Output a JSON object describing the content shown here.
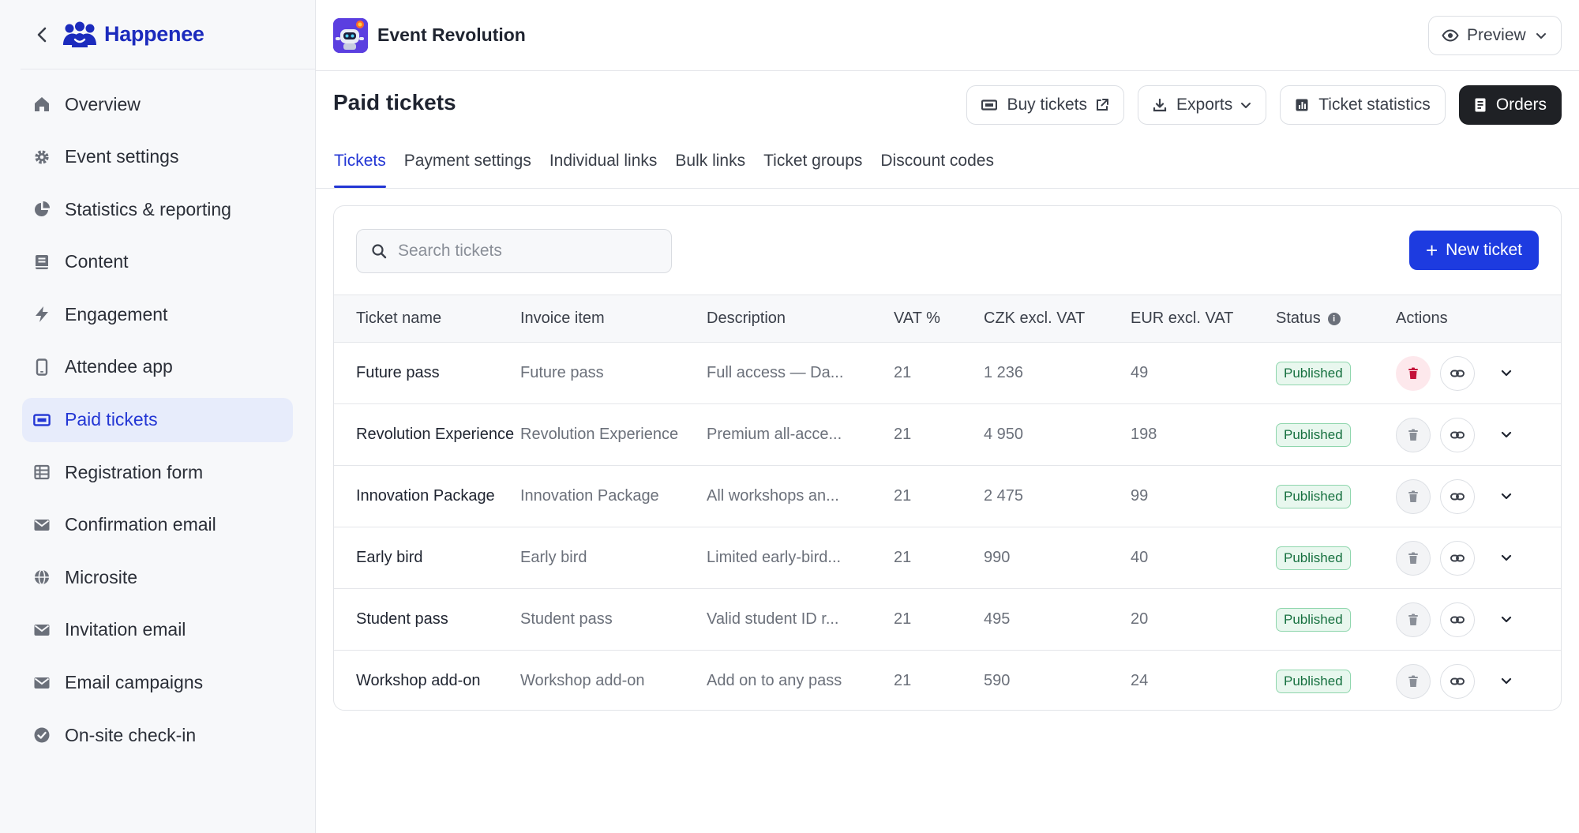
{
  "brand": {
    "name": "Happenee"
  },
  "sidebar": {
    "items": [
      {
        "label": "Overview",
        "icon": "home-icon"
      },
      {
        "label": "Event settings",
        "icon": "gear-icon"
      },
      {
        "label": "Statistics & reporting",
        "icon": "pie-chart-icon"
      },
      {
        "label": "Content",
        "icon": "book-icon"
      },
      {
        "label": "Engagement",
        "icon": "lightning-icon"
      },
      {
        "label": "Attendee app",
        "icon": "phone-icon"
      },
      {
        "label": "Paid tickets",
        "icon": "ticket-icon",
        "active": true
      },
      {
        "label": "Registration form",
        "icon": "table-icon"
      },
      {
        "label": "Confirmation email",
        "icon": "envelope-icon"
      },
      {
        "label": "Microsite",
        "icon": "globe-icon"
      },
      {
        "label": "Invitation email",
        "icon": "envelope-icon"
      },
      {
        "label": "Email campaigns",
        "icon": "envelope-icon"
      },
      {
        "label": "On-site check-in",
        "icon": "check-circle-icon"
      }
    ]
  },
  "header": {
    "event_title": "Event Revolution",
    "preview_label": "Preview"
  },
  "page": {
    "title": "Paid tickets",
    "actions": {
      "buy_tickets": "Buy tickets",
      "exports": "Exports",
      "ticket_statistics": "Ticket statistics",
      "orders": "Orders"
    },
    "tabs": [
      "Tickets",
      "Payment settings",
      "Individual links",
      "Bulk links",
      "Ticket groups",
      "Discount codes"
    ],
    "active_tab": "Tickets"
  },
  "search": {
    "placeholder": "Search tickets",
    "value": ""
  },
  "new_ticket_label": "New ticket",
  "table": {
    "columns": [
      "Ticket name",
      "Invoice item",
      "Description",
      "VAT %",
      "CZK excl. VAT",
      "EUR excl. VAT",
      "Status",
      "Actions"
    ],
    "rows": [
      {
        "name": "Future pass",
        "invoice": "Future pass",
        "description": "Full access — Da...",
        "vat": "21",
        "czk": "1 236",
        "eur": "49",
        "status": "Published"
      },
      {
        "name": "Revolution Experience",
        "invoice": "Revolution Experience",
        "description": "Premium all-acce...",
        "vat": "21",
        "czk": "4 950",
        "eur": "198",
        "status": "Published"
      },
      {
        "name": "Innovation Package",
        "invoice": "Innovation Package",
        "description": "All workshops an...",
        "vat": "21",
        "czk": "2 475",
        "eur": "99",
        "status": "Published"
      },
      {
        "name": "Early bird",
        "invoice": "Early bird",
        "description": "Limited early-bird...",
        "vat": "21",
        "czk": "990",
        "eur": "40",
        "status": "Published"
      },
      {
        "name": "Student pass",
        "invoice": "Student pass",
        "description": "Valid student ID r...",
        "vat": "21",
        "czk": "495",
        "eur": "20",
        "status": "Published"
      },
      {
        "name": "Workshop add-on",
        "invoice": "Workshop add-on",
        "description": "Add on to any pass",
        "vat": "21",
        "czk": "590",
        "eur": "24",
        "status": "Published"
      }
    ]
  },
  "colors": {
    "accent": "#2336d4",
    "primary_button": "#1d3be0",
    "published_bg": "#e8f7ee",
    "published_text": "#16703f",
    "danger": "#c4123a"
  }
}
